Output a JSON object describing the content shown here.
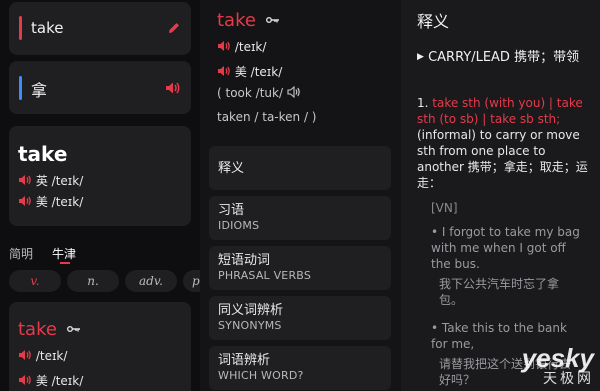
{
  "panel1": {
    "search": {
      "value": "take"
    },
    "translation": {
      "value": "拿"
    },
    "entry": {
      "headword": "take",
      "uk_label": "英",
      "uk_ipa": "/teɪk/",
      "us_label": "美",
      "us_ipa": "/teɪk/"
    },
    "tabs": {
      "simple": "简明",
      "oxford": "牛津"
    },
    "pos": [
      "v.",
      "n.",
      "adv.",
      "p"
    ],
    "entry2": {
      "headword": "take",
      "ipa1": "/teɪk/",
      "us_label": "美",
      "ipa2": "/teɪk/"
    }
  },
  "panel2": {
    "headword": "take",
    "ipa1": "/teɪk/",
    "us_label": "美",
    "ipa2": "/teɪk/",
    "past": "( took /tuk/",
    "pp": "taken / ta-ken / )",
    "menu": [
      {
        "title": "释义",
        "sub": ""
      },
      {
        "title": "习语",
        "sub": "IDIOMS"
      },
      {
        "title": "短语动词",
        "sub": "PHRASAL VERBS"
      },
      {
        "title": "同义词辨析",
        "sub": "SYNONYMS"
      },
      {
        "title": "词语辨析",
        "sub": "WHICH WORD?"
      }
    ]
  },
  "panel3": {
    "heading": "释义",
    "section": "CARRY/LEAD 携带；带领",
    "sense_num": "1.",
    "sense_forms": "take sth (with you) | take sth (to sb) | take sb sth;",
    "sense_def": "(informal) to carry or move sth from one place to another 携带；拿走；取走；运走：",
    "pattern": "[VN]",
    "examples": [
      {
        "en": "I forgot to take my bag with me when I got off the bus.",
        "zh": "我下公共汽车时忘了拿包。"
      },
      {
        "en": "Take this to the bank for me,",
        "zh": "请替我把这个送到银行去好吗？"
      }
    ]
  },
  "watermark": {
    "main": "yesky",
    "sub": "天极网"
  },
  "colors": {
    "accent": "#e63a4a",
    "blue": "#3d8bff",
    "bg": "#0e0e10",
    "card": "#1f1f22"
  }
}
